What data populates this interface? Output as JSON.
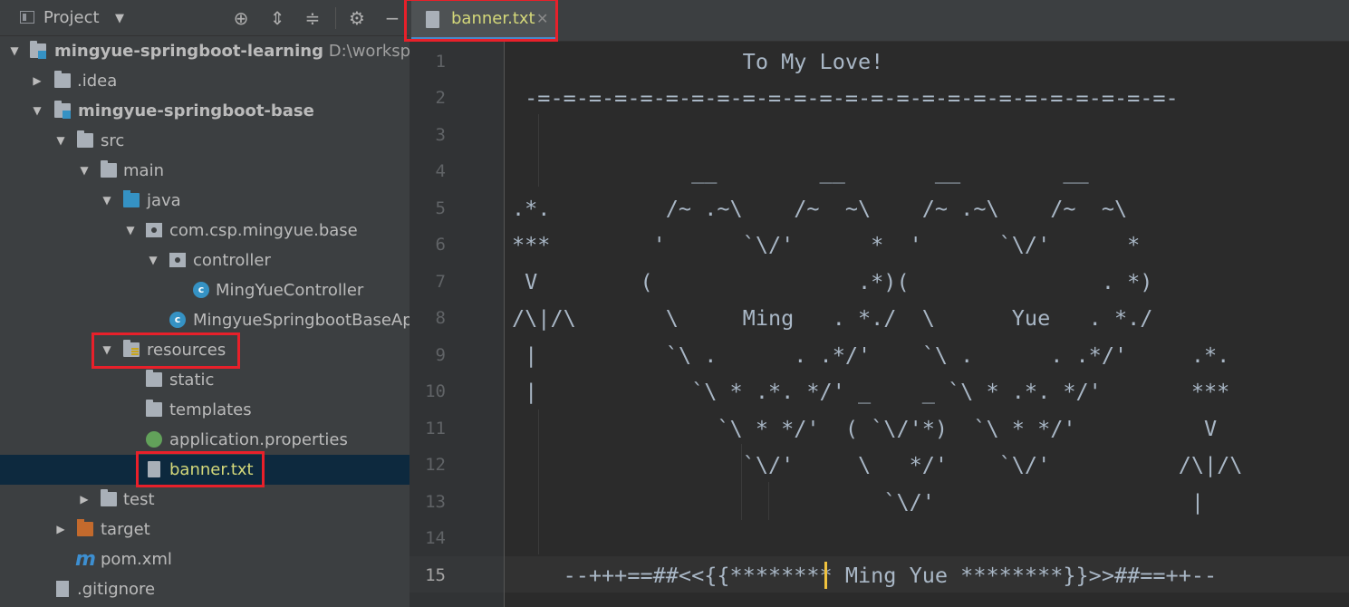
{
  "project_panel": {
    "title": "Project",
    "tree": [
      {
        "label": "mingyue-springboot-learning",
        "path": "D:\\workspace"
      },
      {
        "label": ".idea"
      },
      {
        "label": "mingyue-springboot-base"
      },
      {
        "label": "src"
      },
      {
        "label": "main"
      },
      {
        "label": "java"
      },
      {
        "label": "com.csp.mingyue.base"
      },
      {
        "label": "controller"
      },
      {
        "label": "MingYueController"
      },
      {
        "label": "MingyueSpringbootBaseAp"
      },
      {
        "label": "resources"
      },
      {
        "label": "static"
      },
      {
        "label": "templates"
      },
      {
        "label": "application.properties"
      },
      {
        "label": "banner.txt"
      },
      {
        "label": "test"
      },
      {
        "label": "target"
      },
      {
        "label": "pom.xml"
      },
      {
        "label": ".gitignore"
      }
    ]
  },
  "editor": {
    "tab_label": "banner.txt",
    "line_numbers": [
      "1",
      "2",
      "3",
      "4",
      "5",
      "6",
      "7",
      "8",
      "9",
      "10",
      "11",
      "12",
      "13",
      "14",
      "15"
    ],
    "lines": [
      "                  To My Love!",
      " -=-=-=-=-=-=-=-=-=-=-=-=-=-=-=-=-=-=-=-=-=-=-=-=-=-",
      "",
      "              __        __       __        __",
      ".*.         /~ .~\\    /~  ~\\    /~ .~\\    /~  ~\\",
      "***        '      `\\/'      *  '      `\\/'      *",
      " V        (                .*)(               . *)",
      "/\\|/\\       \\     Ming   . *./  \\      Yue   . *./",
      " |          `\\ .      . .*/'    `\\ .      . .*/'     .*.",
      " |            `\\ * .*. */' _    _ `\\ * .*. */'       ***",
      "                `\\ * */'  ( `\\/'*)  `\\ * */'          V",
      "                  `\\/'     \\   */'    `\\/'          /\\|/\\",
      "                             `\\/'                    |",
      "",
      "    --+++==##<<{{******** Ming Yue ********}}>>##==++--"
    ]
  },
  "colors": {
    "panel_bg": "#3c3f41",
    "editor_bg": "#2b2b2b",
    "selection": "#0d293e",
    "tab_text": "#d4d87a",
    "highlight_box": "#e8202a"
  }
}
